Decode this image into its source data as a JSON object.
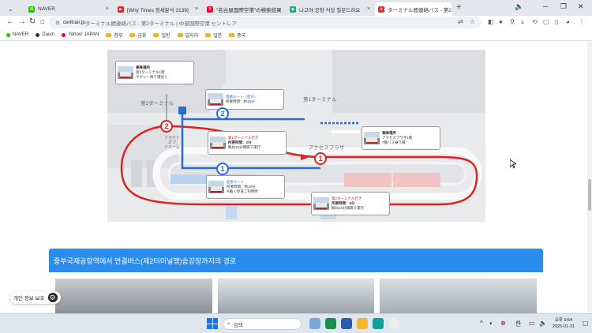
{
  "tabs": [
    {
      "label": "NAVER",
      "active": false
    },
    {
      "label": "[Why Times 정세분석 3139]",
      "active": false
    },
    {
      "label": "\"名古屋国際空港\"の検索結果",
      "active": false
    },
    {
      "label": "나고야 공항 식당 질문드려요",
      "active": false
    },
    {
      "label": "ターミナル間連絡バス - 第2ターミ",
      "active": true
    }
  ],
  "address": {
    "host": "centrair.jp",
    "rest": "  ターミナル間連絡バス - 第2ターミナル | 中部国際空港 セントレア"
  },
  "bookmarks": [
    {
      "label": "NAVER",
      "type": "dot",
      "color": "#1ec800"
    },
    {
      "label": "Daum",
      "type": "dot",
      "color": "#333333"
    },
    {
      "label": "Yahoo! JAPAN",
      "type": "dot",
      "color": "#ff0033"
    },
    {
      "label": "정부",
      "type": "folder"
    },
    {
      "label": "금융",
      "type": "folder"
    },
    {
      "label": "일반",
      "type": "folder"
    },
    {
      "label": "일자리",
      "type": "folder"
    },
    {
      "label": "일본",
      "type": "folder"
    },
    {
      "label": "중국",
      "type": "folder"
    }
  ],
  "map": {
    "terminal2_label": "第2ターミナル",
    "terminal1_label": "第1ターミナル",
    "flight_label": "フライト\nオブ\nドリーム",
    "access_label": "アクセスプラザ",
    "callouts": {
      "t2_stop": {
        "title": "乗降場所",
        "line1": "第2ターミナル1階",
        "line2": "タクシー降り場近く"
      },
      "return": {
        "title": "復路ルート（屋外）",
        "line1": "所要時間：約10分"
      },
      "bus_t1": {
        "title": "第1ターミナル行き",
        "line1": "所要時間：2分",
        "line2": "概ね15分間隔で運行"
      },
      "access_stop": {
        "title": "乗降場所",
        "line1": "アクセスプラザ1階",
        "line2": "7番バス乗り場"
      },
      "walk": {
        "title": "徒歩ルート",
        "line1": "所要時間：約10分",
        "line2": "※動く歩道ご利用時"
      },
      "bus_t2": {
        "title": "第2ターミナル行き",
        "line1": "所要時間：5分",
        "line2": "概ね15分間隔で運行"
      }
    },
    "markers": {
      "red1": "1",
      "red2": "2",
      "blue1": "1",
      "blue2": "2"
    }
  },
  "section": {
    "heading": "중부국제공항역에서 연결버스(제2터미널행)승강장까지의 경로"
  },
  "privacy": {
    "label": "개인 정보 보호"
  },
  "taskbar": {
    "search_placeholder": "검색",
    "lang": "한",
    "time": "오후 9:54",
    "date": "2025-01-31"
  },
  "colors": {
    "accent_blue": "#2b8cf0",
    "route_red": "#e02020",
    "route_blue": "#2a6dcc"
  }
}
